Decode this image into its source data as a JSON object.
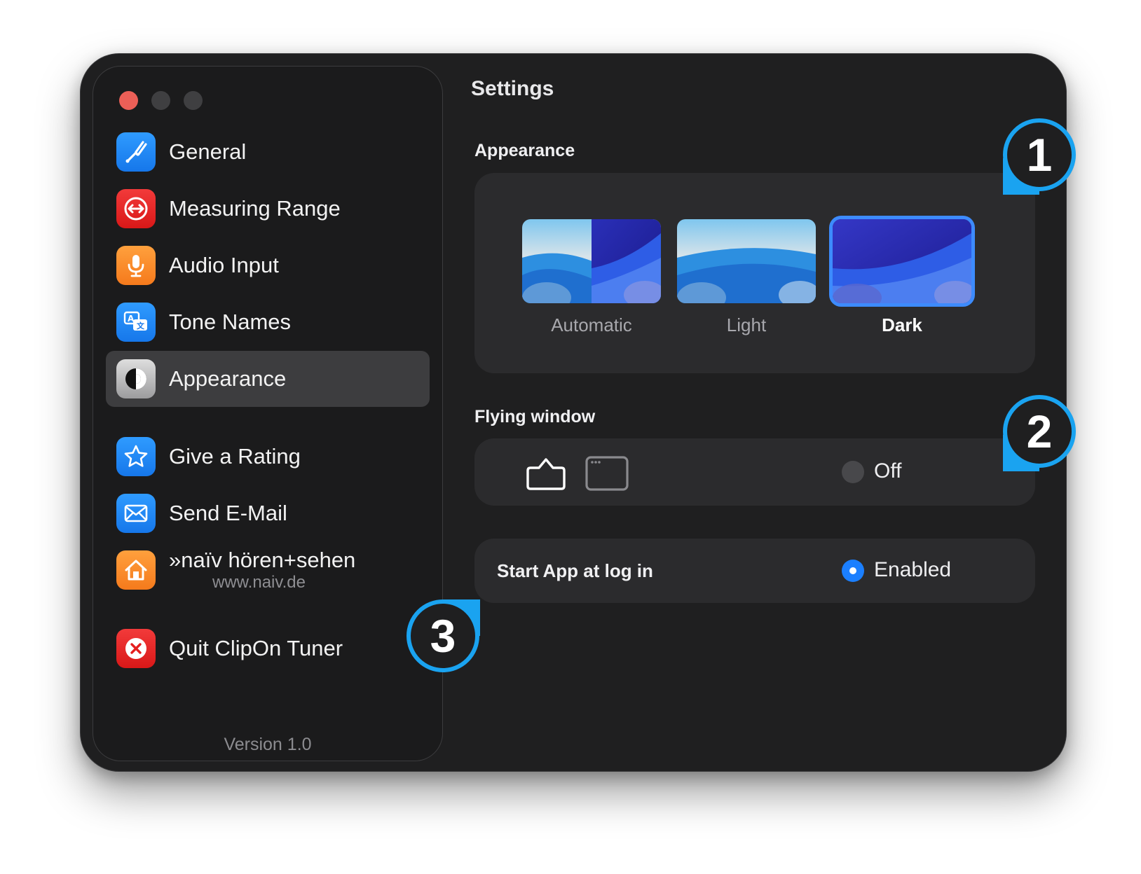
{
  "window": {
    "title": "Settings"
  },
  "sidebar": {
    "items": [
      {
        "label": "General",
        "icon": "tuning-fork-icon"
      },
      {
        "label": "Measuring Range",
        "icon": "range-arrows-icon"
      },
      {
        "label": "Audio Input",
        "icon": "microphone-icon"
      },
      {
        "label": "Tone Names",
        "icon": "translate-icon"
      },
      {
        "label": "Appearance",
        "icon": "appearance-icon",
        "selected": true
      },
      {
        "label": "Give a Rating",
        "icon": "star-icon"
      },
      {
        "label": "Send E-Mail",
        "icon": "envelope-icon"
      },
      {
        "label": "»naïv hören+sehen",
        "sublabel": "www.naiv.de",
        "icon": "home-icon"
      },
      {
        "label": "Quit ClipOn Tuner",
        "icon": "close-circle-icon"
      }
    ],
    "version": "Version 1.0"
  },
  "appearance": {
    "heading": "Appearance",
    "options": [
      {
        "label": "Automatic",
        "selected": false
      },
      {
        "label": "Light",
        "selected": false
      },
      {
        "label": "Dark",
        "selected": true
      }
    ]
  },
  "flying_window": {
    "heading": "Flying window",
    "status": "Off",
    "icons": [
      "floating-window-icon",
      "standard-window-icon"
    ]
  },
  "login": {
    "label": "Start App at log in",
    "status": "Enabled"
  },
  "badges": [
    "1",
    "2",
    "3"
  ],
  "colors": {
    "accent": "#1b7fff",
    "badge_ring": "#1aa3f0",
    "close": "#ec5f57"
  }
}
